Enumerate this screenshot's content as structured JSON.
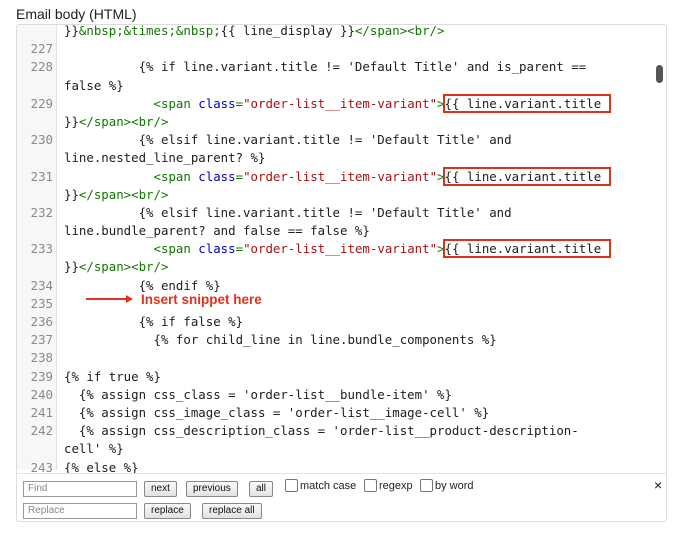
{
  "title": "Email body (HTML)",
  "annotation": "Insert snippet here",
  "lines": [
    {
      "n": "",
      "segs": [
        {
          "c": "t-liq",
          "t": "}}"
        },
        {
          "c": "t-tag",
          "t": "&nbsp;&times;&nbsp;"
        },
        {
          "c": "t-liq",
          "t": "{{ line_display }}"
        },
        {
          "c": "t-tag",
          "t": "</span><br/>"
        }
      ]
    },
    {
      "n": "227",
      "segs": []
    },
    {
      "n": "228",
      "segs": [
        {
          "c": "t-liq",
          "t": "          {% if line.variant.title != 'Default Title' and is_parent =="
        }
      ]
    },
    {
      "n": "",
      "segs": [
        {
          "c": "t-liq",
          "t": "false %}"
        }
      ]
    },
    {
      "n": "229",
      "segs": [
        {
          "c": "t-liq",
          "t": "            "
        },
        {
          "c": "t-tag",
          "t": "<span "
        },
        {
          "c": "t-attr",
          "t": "class"
        },
        {
          "c": "t-tag",
          "t": "="
        },
        {
          "c": "t-str",
          "t": "\"order-list__item-variant\""
        },
        {
          "c": "t-tag",
          "t": ">"
        },
        {
          "c": "t-liq hl",
          "t": "{{ line.variant.title "
        }
      ]
    },
    {
      "n": "",
      "segs": [
        {
          "c": "t-liq",
          "t": "}}"
        },
        {
          "c": "t-tag",
          "t": "</span><br/>"
        }
      ]
    },
    {
      "n": "230",
      "segs": [
        {
          "c": "t-liq",
          "t": "          {% elsif line.variant.title != 'Default Title' and"
        }
      ]
    },
    {
      "n": "",
      "segs": [
        {
          "c": "t-liq",
          "t": "line.nested_line_parent? %}"
        }
      ]
    },
    {
      "n": "231",
      "segs": [
        {
          "c": "t-liq",
          "t": "            "
        },
        {
          "c": "t-tag",
          "t": "<span "
        },
        {
          "c": "t-attr",
          "t": "class"
        },
        {
          "c": "t-tag",
          "t": "="
        },
        {
          "c": "t-str",
          "t": "\"order-list__item-variant\""
        },
        {
          "c": "t-tag",
          "t": ">"
        },
        {
          "c": "t-liq hl",
          "t": "{{ line.variant.title "
        }
      ]
    },
    {
      "n": "",
      "segs": [
        {
          "c": "t-liq",
          "t": "}}"
        },
        {
          "c": "t-tag",
          "t": "</span><br/>"
        }
      ]
    },
    {
      "n": "232",
      "segs": [
        {
          "c": "t-liq",
          "t": "          {% elsif line.variant.title != 'Default Title' and"
        }
      ]
    },
    {
      "n": "",
      "segs": [
        {
          "c": "t-liq",
          "t": "line.bundle_parent? and false == false %}"
        }
      ]
    },
    {
      "n": "233",
      "segs": [
        {
          "c": "t-liq",
          "t": "            "
        },
        {
          "c": "t-tag",
          "t": "<span "
        },
        {
          "c": "t-attr",
          "t": "class"
        },
        {
          "c": "t-tag",
          "t": "="
        },
        {
          "c": "t-str",
          "t": "\"order-list__item-variant\""
        },
        {
          "c": "t-tag",
          "t": ">"
        },
        {
          "c": "t-liq hl",
          "t": "{{ line.variant.title "
        }
      ]
    },
    {
      "n": "",
      "segs": [
        {
          "c": "t-liq",
          "t": "}}"
        },
        {
          "c": "t-tag",
          "t": "</span><br/>"
        }
      ]
    },
    {
      "n": "234",
      "segs": [
        {
          "c": "t-liq",
          "t": "          {% endif %}"
        }
      ]
    },
    {
      "n": "235",
      "segs": []
    },
    {
      "n": "236",
      "segs": [
        {
          "c": "t-liq",
          "t": "          {% if false %}"
        }
      ]
    },
    {
      "n": "237",
      "segs": [
        {
          "c": "t-liq",
          "t": "            {% for child_line in line.bundle_components %}"
        }
      ]
    },
    {
      "n": "238",
      "segs": []
    },
    {
      "n": "239",
      "segs": [
        {
          "c": "t-liq",
          "t": "{% if true %}"
        }
      ]
    },
    {
      "n": "240",
      "segs": [
        {
          "c": "t-liq",
          "t": "  {% assign css_class = 'order-list__bundle-item' %}"
        }
      ]
    },
    {
      "n": "241",
      "segs": [
        {
          "c": "t-liq",
          "t": "  {% assign css_image_class = 'order-list__image-cell' %}"
        }
      ]
    },
    {
      "n": "242",
      "segs": [
        {
          "c": "t-liq",
          "t": "  {% assign css_description_class = 'order-list__product-description-"
        }
      ]
    },
    {
      "n": "",
      "segs": [
        {
          "c": "t-liq",
          "t": "cell' %}"
        }
      ]
    },
    {
      "n": "243",
      "segs": [
        {
          "c": "t-liq",
          "t": "{% else %}"
        }
      ]
    }
  ],
  "find": {
    "find_placeholder": "Find",
    "replace_placeholder": "Replace",
    "next": "next",
    "previous": "previous",
    "all": "all",
    "match_case": "match case",
    "regexp": "regexp",
    "by_word": "by word",
    "close": "×",
    "replace": "replace",
    "replace_all": "replace all"
  }
}
